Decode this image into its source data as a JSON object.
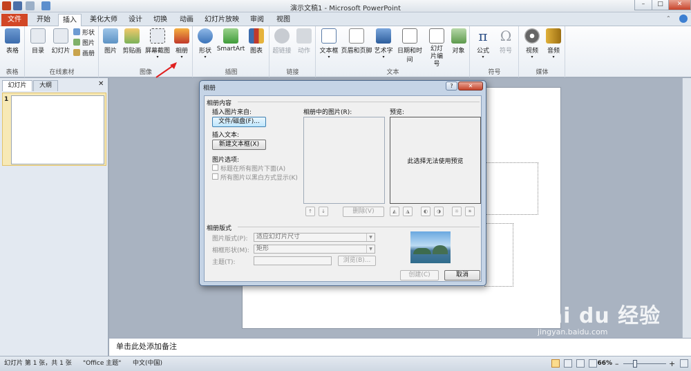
{
  "window": {
    "title": "演示文稿1 - Microsoft PowerPoint",
    "min": "–",
    "max": "□",
    "close": "✕"
  },
  "tabs": [
    "文件",
    "开始",
    "插入",
    "美化大师",
    "设计",
    "切换",
    "动画",
    "幻灯片放映",
    "审阅",
    "视图"
  ],
  "active_tab": "插入",
  "ribbon": {
    "table": {
      "btn": "表格",
      "group": "表格"
    },
    "online": {
      "btns": [
        "目录",
        "幻灯片"
      ],
      "small": [
        "形状",
        "图片",
        "画册"
      ],
      "group": "在线素材"
    },
    "image": {
      "btns": [
        "图片",
        "剪贴画",
        "屏幕截图",
        "相册"
      ],
      "group": "图像"
    },
    "illustr": {
      "btns": [
        "形状",
        "SmartArt",
        "图表"
      ],
      "group": "插图"
    },
    "links": {
      "btns": [
        "超链接",
        "动作"
      ],
      "group": "链接"
    },
    "text": {
      "btns": [
        "文本框",
        "页眉和页脚",
        "艺术字",
        "日期和时间",
        "幻灯片编号",
        "对象"
      ],
      "group": "文本"
    },
    "symbols": {
      "btns": [
        "公式",
        "符号"
      ],
      "group": "符号"
    },
    "media": {
      "btns": [
        "视频",
        "音频"
      ],
      "group": "媒体"
    }
  },
  "leftpane": {
    "tabs": [
      "幻灯片",
      "大纲"
    ],
    "close": "✕",
    "slide_num": "1"
  },
  "notes_placeholder": "单击此处添加备注",
  "dialog": {
    "title": "相册",
    "help": "?",
    "close": "✕",
    "section_content": "相册内容",
    "insert_from": "插入图片来自:",
    "file_disk_btn": "文件/磁盘(F)...",
    "insert_text": "插入文本:",
    "new_textbox_btn": "新建文本框(X)",
    "pic_options": "图片选项:",
    "opt1": "标题在所有图片下面(A)",
    "opt2": "所有图片以黑白方式显示(K)",
    "pics_in_album": "相册中的图片(R):",
    "preview": "预览:",
    "preview_msg": "此选择无法使用预览",
    "up": "↑",
    "down": "↓",
    "delete_btn": "删除(V)",
    "section_layout": "相册版式",
    "pic_layout_label": "图片版式(P):",
    "pic_layout_value": "适应幻灯片尺寸",
    "frame_shape_label": "相框形状(M):",
    "frame_shape_value": "矩形",
    "theme_label": "主题(T):",
    "browse_btn": "浏览(B)...",
    "create_btn": "创建(C)",
    "cancel_btn": "取消"
  },
  "status": {
    "slide": "幻灯片 第 1 张，共 1 张",
    "theme": "\"Office 主题\"",
    "lang": "中文(中国)",
    "zoom": "66%",
    "zoom_minus": "–",
    "zoom_plus": "+"
  },
  "watermark": {
    "brand": "Bai du 经验",
    "url": "jingyan.baidu.com"
  },
  "colors": {
    "file_tab": "#d24726",
    "dialog_frame": "#c5d4e6",
    "accent": "#3c7fb1"
  }
}
